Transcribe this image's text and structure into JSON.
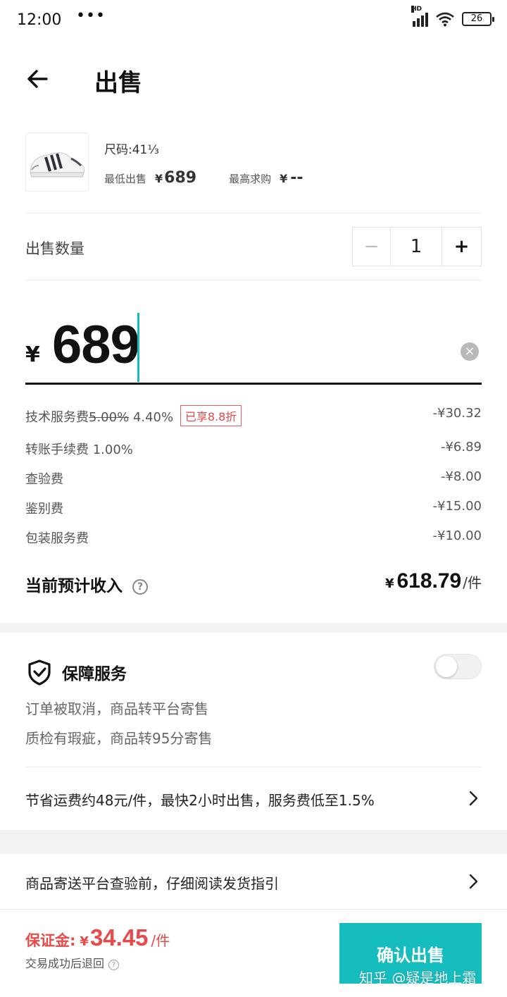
{
  "status_bar": {
    "time": "12:00",
    "dots": "•••",
    "network": "HD",
    "battery": "26"
  },
  "header": {
    "title": "出售"
  },
  "product": {
    "size": "尺码:41⅓",
    "lowest_sell_label": "最低出售",
    "lowest_sell_currency": "¥",
    "lowest_sell_value": "689",
    "highest_bid_label": "最高求购",
    "highest_bid_currency": "¥",
    "highest_bid_value": "--"
  },
  "quantity": {
    "label": "出售数量",
    "minus": "−",
    "value": "1",
    "plus": "+"
  },
  "price_input": {
    "currency": "¥",
    "value": "689",
    "clear": "×"
  },
  "fees": [
    {
      "label": "技术服务费",
      "original_rate": "5.00%",
      "rate": " 4.40%",
      "badge": "已享8.8折",
      "amount": "-¥30.32"
    },
    {
      "label": "转账手续费 1.00%",
      "amount": "-¥6.89"
    },
    {
      "label": "查验费",
      "amount": "-¥8.00"
    },
    {
      "label": "鉴别费",
      "amount": "-¥15.00"
    },
    {
      "label": "包装服务费",
      "amount": "-¥10.00"
    }
  ],
  "income": {
    "label": "当前预计收入",
    "help": "?",
    "currency": "¥",
    "value": "618.79",
    "unit": "/件"
  },
  "guarantee": {
    "title": "保障服务",
    "enabled": false,
    "lines": [
      "订单被取消，商品转平台寄售",
      "质检有瑕疵，商品转95分寄售"
    ]
  },
  "promo": {
    "text": "节省运费约48元/件，最快2小时出售，服务费低至1.5%"
  },
  "shipping_guide": {
    "text": "商品寄送平台查验前，仔细阅读发货指引"
  },
  "bottom_bar": {
    "deposit_label": "保证金:",
    "deposit_currency": "¥",
    "deposit_value": "34.45",
    "deposit_unit": "/件",
    "refund_note": "交易成功后退回",
    "refund_help": "?",
    "confirm_label": "确认出售",
    "watermark": "知乎 @疑是地上霜"
  },
  "colors": {
    "accent": "#16bdbf",
    "danger": "#e84a4a",
    "text_secondary": "#555555"
  }
}
